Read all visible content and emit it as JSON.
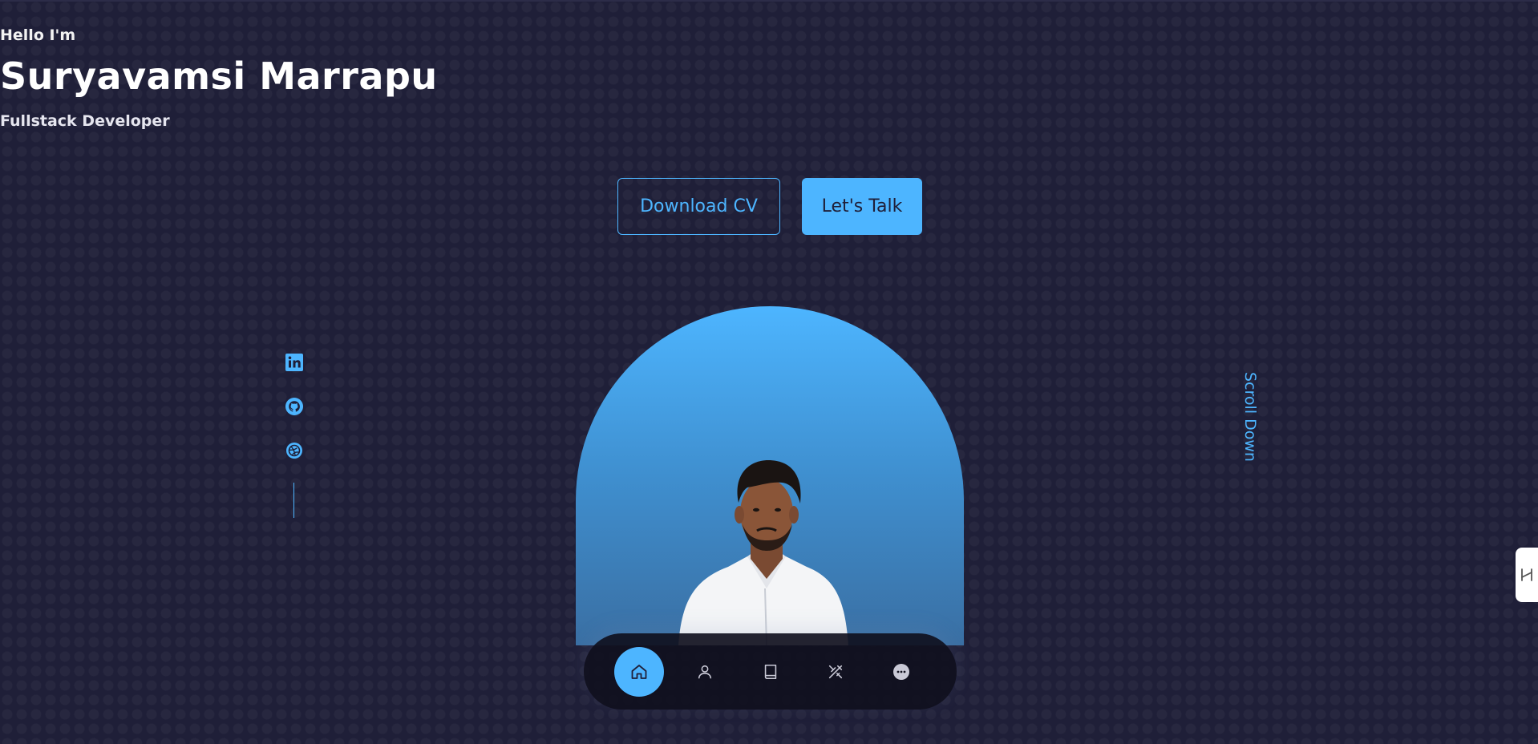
{
  "hero": {
    "greeting": "Hello I'm",
    "name": "Suryavamsi Marrapu",
    "role": "Fullstack Developer"
  },
  "cta": {
    "download_label": "Download CV",
    "talk_label": "Let's Talk"
  },
  "socials": {
    "items": [
      {
        "icon": "linkedin-icon"
      },
      {
        "icon": "github-icon"
      },
      {
        "icon": "dribbble-icon"
      }
    ]
  },
  "scroll": {
    "label": "Scroll Down"
  },
  "nav": {
    "items": [
      {
        "icon": "home-icon",
        "active": true
      },
      {
        "icon": "user-icon",
        "active": false
      },
      {
        "icon": "book-icon",
        "active": false
      },
      {
        "icon": "tools-icon",
        "active": false
      },
      {
        "icon": "chat-icon",
        "active": false
      }
    ]
  },
  "colors": {
    "background": "#1f1f38",
    "accent": "#4db5ff",
    "text": "#ffffff"
  }
}
